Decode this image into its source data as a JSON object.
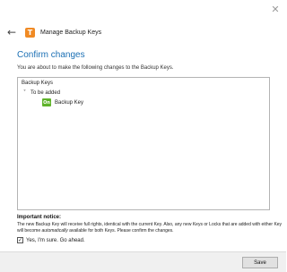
{
  "window": {
    "title": "Manage Backup Keys",
    "close_glyph": "✕",
    "back_glyph": "←",
    "logo_letter": "T",
    "logo_color": "#f08a24"
  },
  "page": {
    "heading": "Confirm changes",
    "intro": "You are about to make the following changes to the Backup Keys."
  },
  "tree": {
    "root_label": "Backup Keys",
    "group": {
      "label": "To be added",
      "expanded": true,
      "chevron_glyph": "˅"
    },
    "items": [
      {
        "label": "Backup Key",
        "icon": "key-icon",
        "icon_text": "On",
        "icon_color": "#5fb32a"
      }
    ]
  },
  "notice": {
    "title": "Important notice:",
    "text_part1": "The new Backup Key will receive full rights, identical with the current Key. Also, any new Keys or Locks that are added with either Key will become ",
    "text_emphasis": "automatically",
    "text_part2": " available for both Keys. Please confirm the changes."
  },
  "confirm": {
    "checked": true,
    "check_glyph": "✓",
    "label": "Yes, I'm sure. Go ahead."
  },
  "footer": {
    "save_label": "Save"
  }
}
